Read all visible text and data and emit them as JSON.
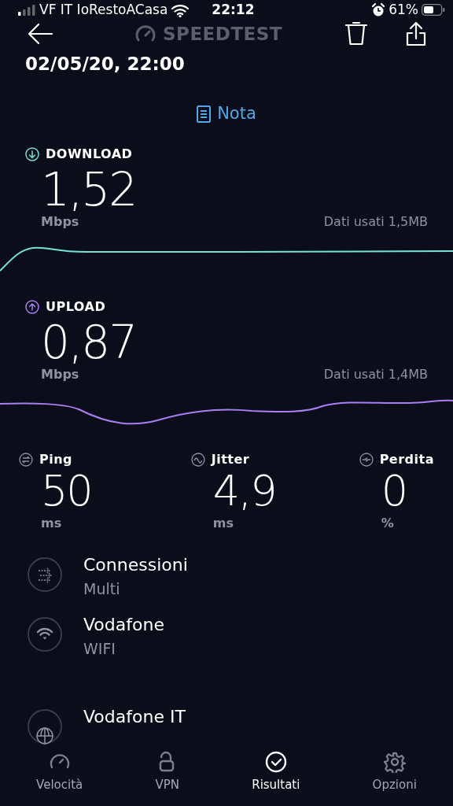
{
  "status_bar": {
    "carrier": "VF IT IoRestoACasa",
    "time": "22:12",
    "battery": "61%"
  },
  "header": {
    "logo": "SPEEDTEST"
  },
  "date": "02/05/20, 22:00",
  "note_link": "Nota",
  "speeds": [
    {
      "kind": "download",
      "label": "DOWNLOAD",
      "value": "1,52",
      "unit": "Mbps",
      "data_used": "Dati usati 1,5MB",
      "color": "#74e3d4"
    },
    {
      "kind": "upload",
      "label": "UPLOAD",
      "value": "0,87",
      "unit": "Mbps",
      "data_used": "Dati usati 1,4MB",
      "color": "#a97ef2"
    }
  ],
  "metrics": [
    {
      "kind": "ping",
      "label": "Ping",
      "value": "50",
      "unit": "ms"
    },
    {
      "kind": "jitter",
      "label": "Jitter",
      "value": "4,9",
      "unit": "ms"
    },
    {
      "kind": "loss",
      "label": "Perdita",
      "value": "0",
      "unit": "%"
    }
  ],
  "details": [
    {
      "kind": "multi",
      "title": "Connessioni",
      "subtitle": "Multi"
    },
    {
      "kind": "wifi",
      "title": "Vodafone",
      "subtitle": "WIFI"
    },
    {
      "kind": "globe",
      "title": "Vodafone IT"
    }
  ],
  "tabs": [
    {
      "kind": "speed",
      "label": "Velocità",
      "selected": false
    },
    {
      "kind": "vpn",
      "label": "VPN",
      "selected": false
    },
    {
      "kind": "results",
      "label": "Risultati",
      "selected": true
    },
    {
      "kind": "settings",
      "label": "Opzioni",
      "selected": false
    }
  ]
}
